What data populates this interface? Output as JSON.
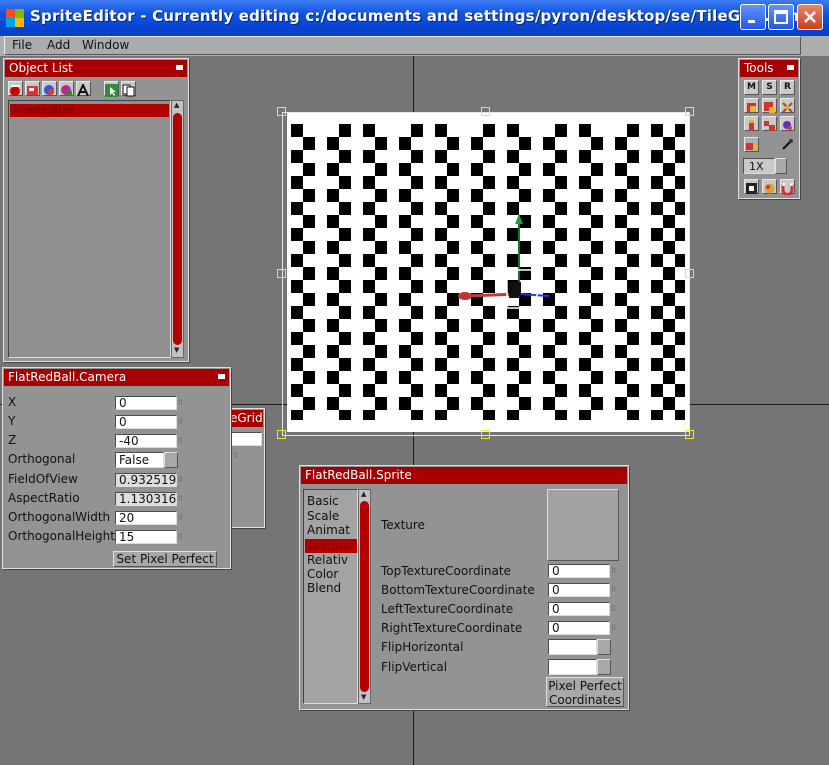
{
  "window": {
    "title": "SpriteEditor - Currently editing c:/documents and settings/pyron/desktop/se/TileGrid.scnx"
  },
  "menu": {
    "items": [
      "File",
      "Add",
      "Window"
    ]
  },
  "object_list": {
    "title": "Object List",
    "selected_item": "FlatRedBall"
  },
  "camera": {
    "title": "FlatRedBall.Camera",
    "fields": [
      {
        "label": "X",
        "value": "0"
      },
      {
        "label": "Y",
        "value": "0"
      },
      {
        "label": "Z",
        "value": "-40"
      },
      {
        "label": "Orthogonal",
        "value": "False"
      },
      {
        "label": "FieldOfView",
        "value": "0.932519"
      },
      {
        "label": "AspectRatio",
        "value": "1.130316"
      },
      {
        "label": "OrthogonalWidth",
        "value": "20"
      },
      {
        "label": "OrthogonalHeight",
        "value": "15"
      }
    ],
    "button": "Set Pixel Perfect"
  },
  "tilegrid_fragment": {
    "title": "eGrid"
  },
  "sprite": {
    "title": "FlatRedBall.Sprite",
    "categories": [
      "Basic",
      "Scale",
      "Animat",
      "Texture",
      "Relativ",
      "Color",
      "Blend"
    ],
    "texture_label": "Texture",
    "coords": [
      {
        "label": "TopTextureCoordinate",
        "value": "0"
      },
      {
        "label": "BottomTextureCoordinate",
        "value": "0"
      },
      {
        "label": "LeftTextureCoordinate",
        "value": "0"
      },
      {
        "label": "RightTextureCoordinate",
        "value": "0"
      }
    ],
    "flips": [
      {
        "label": "FlipHorizontal"
      },
      {
        "label": "FlipVertical"
      }
    ],
    "button": "Pixel Perfect Coordinates",
    "button_line1": "Pixel Perfect",
    "button_line2": "Coordinates"
  },
  "tools": {
    "title": "Tools",
    "row1": [
      "M",
      "S",
      "R"
    ],
    "zoom": "1X"
  },
  "colors": {
    "title_red": "#a80000",
    "xp_blue": "#0845d4",
    "viewport": "#757575"
  }
}
